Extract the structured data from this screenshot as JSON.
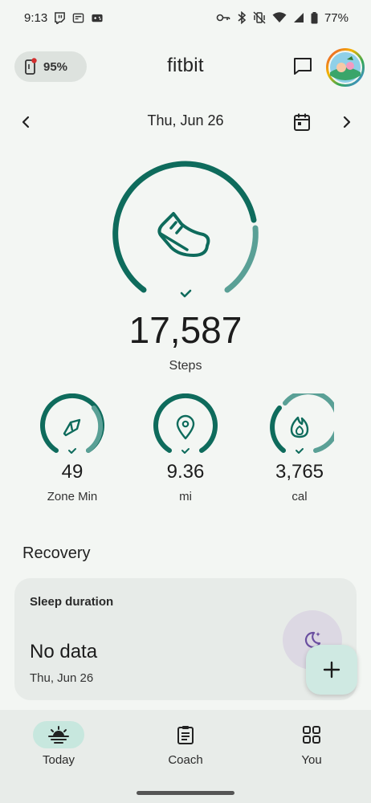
{
  "status_bar": {
    "time": "9:13",
    "battery": "77%",
    "left_icons": [
      "twitch-icon",
      "news-icon",
      "gamepad-icon"
    ],
    "right_icons": [
      "key-icon",
      "bluetooth-icon",
      "vibrate-off-icon",
      "wifi-icon",
      "cell-signal-icon",
      "battery-icon"
    ]
  },
  "header": {
    "device_battery": "95%",
    "title": "fitbit",
    "icons": [
      "phone-device-icon",
      "message-icon",
      "avatar"
    ]
  },
  "date_nav": {
    "date": "Thu, Jun 26",
    "icons": [
      "chevron-left-icon",
      "calendar-icon",
      "chevron-right-icon"
    ]
  },
  "steps": {
    "value": "17,587",
    "label": "Steps",
    "goal_met": true,
    "icon": "shoe-icon"
  },
  "stats": [
    {
      "value": "49",
      "label": "Zone Min",
      "icon": "zone-arrow-icon",
      "goal_met": true
    },
    {
      "value": "9.36",
      "label": "mi",
      "icon": "location-pin-icon",
      "goal_met": true
    },
    {
      "value": "3,765",
      "label": "cal",
      "icon": "flame-icon",
      "goal_met": true
    }
  ],
  "recovery": {
    "section_title": "Recovery",
    "card": {
      "title": "Sleep duration",
      "value": "No data",
      "date": "Thu, Jun 26",
      "icon": "moon-stars-icon"
    }
  },
  "fab": {
    "icon": "plus-icon"
  },
  "bottom_nav": {
    "items": [
      {
        "label": "Today",
        "icon": "sunrise-icon",
        "active": true
      },
      {
        "label": "Coach",
        "icon": "clipboard-icon",
        "active": false
      },
      {
        "label": "You",
        "icon": "grid-icon",
        "active": false
      }
    ]
  },
  "colors": {
    "background": "#f3f6f3",
    "ring_primary": "#0e6b5c",
    "ring_secondary": "#5aa096",
    "active_nav_pill": "#c7e7de",
    "fab_bg": "#cfe9e2",
    "sleep_circle": "#dcd8e3",
    "moon_icon": "#6a4fa0"
  }
}
